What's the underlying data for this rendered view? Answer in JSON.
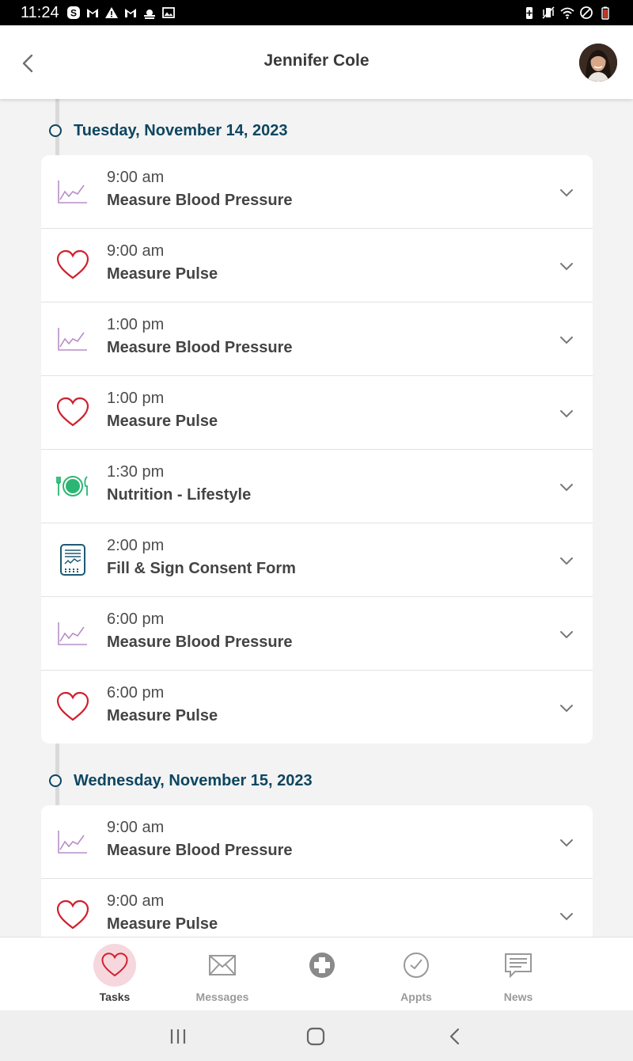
{
  "status_bar": {
    "time": "11:24",
    "left_icons": [
      "s-app-icon",
      "gmail-icon",
      "warning-icon",
      "gmail-icon",
      "weather-icon",
      "image-icon"
    ],
    "right_icons": [
      "battery-saver-icon",
      "vibrate-icon",
      "wifi-icon",
      "do-not-disturb-icon",
      "battery-icon"
    ]
  },
  "header": {
    "title": "Jennifer Cole",
    "back_icon": "back-chevron-icon",
    "avatar": "profile-avatar"
  },
  "days": [
    {
      "label": "Tuesday, November 14, 2023",
      "tasks": [
        {
          "time": "9:00 am",
          "name": "Measure Blood Pressure",
          "icon": "blood-pressure-chart-icon"
        },
        {
          "time": "9:00 am",
          "name": "Measure Pulse",
          "icon": "heart-icon"
        },
        {
          "time": "1:00 pm",
          "name": "Measure Blood Pressure",
          "icon": "blood-pressure-chart-icon"
        },
        {
          "time": "1:00 pm",
          "name": "Measure Pulse",
          "icon": "heart-icon"
        },
        {
          "time": "1:30 pm",
          "name": "Nutrition - Lifestyle",
          "icon": "plate-utensils-icon"
        },
        {
          "time": "2:00 pm",
          "name": "Fill & Sign Consent Form",
          "icon": "form-document-icon"
        },
        {
          "time": "6:00 pm",
          "name": "Measure Blood Pressure",
          "icon": "blood-pressure-chart-icon"
        },
        {
          "time": "6:00 pm",
          "name": "Measure Pulse",
          "icon": "heart-icon"
        }
      ]
    },
    {
      "label": "Wednesday, November 15, 2023",
      "tasks": [
        {
          "time": "9:00 am",
          "name": "Measure Blood Pressure",
          "icon": "blood-pressure-chart-icon"
        },
        {
          "time": "9:00 am",
          "name": "Measure Pulse",
          "icon": "heart-icon"
        }
      ]
    }
  ],
  "bottom_nav": [
    {
      "label": "Tasks",
      "icon": "heart-icon",
      "active": true
    },
    {
      "label": "Messages",
      "icon": "envelope-icon",
      "active": false
    },
    {
      "label": "",
      "icon": "medical-cross-icon",
      "active": false
    },
    {
      "label": "Appts",
      "icon": "clock-check-icon",
      "active": false
    },
    {
      "label": "News",
      "icon": "news-chat-icon",
      "active": false
    }
  ],
  "system_nav": [
    "recent-apps-icon",
    "home-icon",
    "back-icon"
  ],
  "colors": {
    "accent_navy": "#0d4660",
    "heart_red": "#d0202e",
    "chart_purple": "#b58fc8",
    "nutrition_green": "#2bb673",
    "form_teal": "#1d5a73",
    "active_tab_bg": "#f6d7dd",
    "background": "#f3f3f3"
  }
}
